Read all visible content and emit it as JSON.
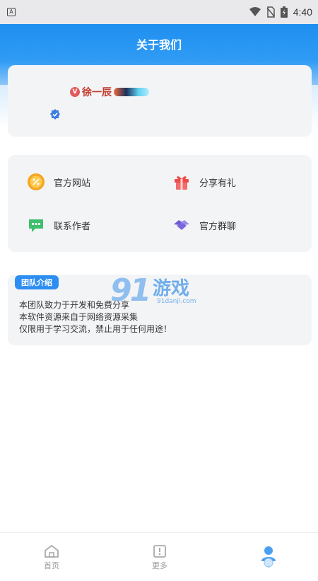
{
  "status_bar": {
    "time": "4:40"
  },
  "header": {
    "title": "关于我们"
  },
  "profile": {
    "username": "徐一辰",
    "vip_badge": "V"
  },
  "menu": {
    "items": [
      {
        "label": "官方网站",
        "icon": "percent-coin-icon",
        "color": "#f5a623"
      },
      {
        "label": "分享有礼",
        "icon": "gift-icon",
        "color": "#ef4a4a"
      },
      {
        "label": "联系作者",
        "icon": "chat-bubble-icon",
        "color": "#3ebf6f"
      },
      {
        "label": "官方群聊",
        "icon": "handshake-icon",
        "color": "#6f5ad6"
      }
    ]
  },
  "team": {
    "tag": "团队介绍",
    "lines": [
      "本团队致力于开发和免费分享",
      "本软件资源来自于网络资源采集",
      "仅限用于学习交流，禁止用于任何用途！"
    ]
  },
  "watermark": {
    "number": "91",
    "text": "游戏",
    "url": "91danji.com"
  },
  "tabs": [
    {
      "label": "首页",
      "icon": "home-icon"
    },
    {
      "label": "更多",
      "icon": "more-icon"
    },
    {
      "label": "",
      "icon": "profile-icon"
    }
  ],
  "colors": {
    "primary": "#2d8ef2",
    "card_bg": "#f3f4f6"
  }
}
